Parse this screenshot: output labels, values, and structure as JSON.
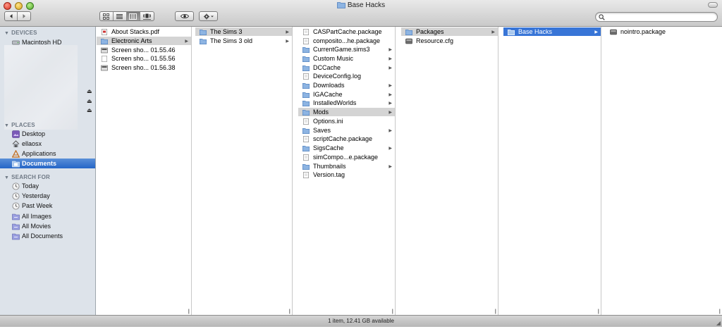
{
  "window": {
    "title": "Base Hacks"
  },
  "toolbar": {
    "back_icon": "chevron-left-icon",
    "forward_icon": "chevron-right-icon",
    "view_modes": [
      "icon-view-icon",
      "list-view-icon",
      "column-view-icon",
      "coverflow-view-icon"
    ],
    "active_view": "column-view-icon",
    "quicklook_icon": "eye-icon",
    "action_icon": "gear-icon",
    "search_placeholder": ""
  },
  "sidebar": {
    "devices_label": "DEVICES",
    "devices": [
      {
        "label": "Macintosh HD",
        "icon": "hard-drive-icon"
      }
    ],
    "places_label": "PLACES",
    "places": [
      {
        "label": "Desktop",
        "icon": "desktop-icon"
      },
      {
        "label": "ellaosx",
        "icon": "home-icon"
      },
      {
        "label": "Applications",
        "icon": "applications-icon"
      },
      {
        "label": "Documents",
        "icon": "documents-icon",
        "selected": true
      }
    ],
    "search_label": "SEARCH FOR",
    "searches": [
      {
        "label": "Today",
        "icon": "clock-icon"
      },
      {
        "label": "Yesterday",
        "icon": "clock-icon"
      },
      {
        "label": "Past Week",
        "icon": "clock-icon"
      },
      {
        "label": "All Images",
        "icon": "smart-folder-icon"
      },
      {
        "label": "All Movies",
        "icon": "smart-folder-icon"
      },
      {
        "label": "All Documents",
        "icon": "smart-folder-icon"
      }
    ]
  },
  "columns": [
    {
      "items": [
        {
          "label": "About Stacks.pdf",
          "icon": "pdf-file-icon"
        },
        {
          "label": "Electronic Arts",
          "icon": "folder-icon",
          "folder": true,
          "state": "gray"
        },
        {
          "label": "Screen sho... 01.55.46",
          "icon": "screenshot-file-icon"
        },
        {
          "label": "Screen sho... 01.55.56",
          "icon": "blank-file-icon"
        },
        {
          "label": "Screen sho... 01.56.38",
          "icon": "screenshot-file-icon"
        }
      ]
    },
    {
      "items": [
        {
          "label": "The Sims 3",
          "icon": "folder-icon",
          "folder": true,
          "state": "gray"
        },
        {
          "label": "The Sims 3 old",
          "icon": "folder-icon",
          "folder": true
        }
      ]
    },
    {
      "items": [
        {
          "label": "CASPartCache.package",
          "icon": "document-file-icon"
        },
        {
          "label": "composito...he.package",
          "icon": "document-file-icon"
        },
        {
          "label": "CurrentGame.sims3",
          "icon": "folder-icon",
          "folder": true
        },
        {
          "label": "Custom Music",
          "icon": "folder-icon",
          "folder": true
        },
        {
          "label": "DCCache",
          "icon": "folder-icon",
          "folder": true
        },
        {
          "label": "DeviceConfig.log",
          "icon": "document-file-icon"
        },
        {
          "label": "Downloads",
          "icon": "folder-icon",
          "folder": true
        },
        {
          "label": "IGACache",
          "icon": "folder-icon",
          "folder": true
        },
        {
          "label": "InstalledWorlds",
          "icon": "folder-icon",
          "folder": true
        },
        {
          "label": "Mods",
          "icon": "folder-icon",
          "folder": true,
          "state": "gray"
        },
        {
          "label": "Options.ini",
          "icon": "document-file-icon"
        },
        {
          "label": "Saves",
          "icon": "folder-icon",
          "folder": true
        },
        {
          "label": "scriptCache.package",
          "icon": "document-file-icon"
        },
        {
          "label": "SigsCache",
          "icon": "folder-icon",
          "folder": true
        },
        {
          "label": "simCompo...e.package",
          "icon": "document-file-icon"
        },
        {
          "label": "Thumbnails",
          "icon": "folder-icon",
          "folder": true
        },
        {
          "label": "Version.tag",
          "icon": "document-file-icon"
        }
      ]
    },
    {
      "items": [
        {
          "label": "Packages",
          "icon": "folder-icon",
          "folder": true,
          "state": "gray"
        },
        {
          "label": "Resource.cfg",
          "icon": "config-file-icon"
        }
      ]
    },
    {
      "items": [
        {
          "label": "Base Hacks",
          "icon": "folder-icon",
          "folder": true,
          "state": "blue"
        }
      ]
    },
    {
      "items": [
        {
          "label": "nointro.package",
          "icon": "package-file-icon"
        }
      ]
    }
  ],
  "status": {
    "text": "1 item, 12.41 GB available"
  }
}
